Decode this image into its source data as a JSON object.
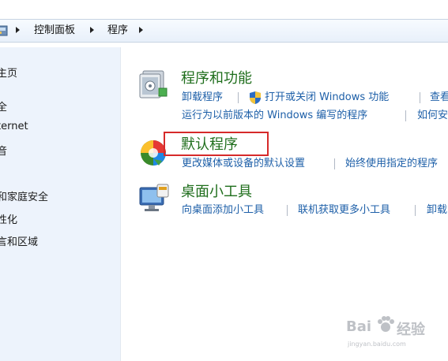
{
  "breadcrumb": {
    "items": [
      "控制面板",
      "程序"
    ]
  },
  "sidebar": {
    "items": [
      {
        "label": "主页"
      },
      {
        "label": "全"
      },
      {
        "label": "ternet"
      },
      {
        "label": "音"
      },
      {
        "label": "和家庭安全"
      },
      {
        "label": "性化"
      },
      {
        "label": "言和区域"
      }
    ]
  },
  "categories": [
    {
      "title": "程序和功能",
      "icon": "programs-features-icon",
      "links_row1": [
        "卸载程序",
        "打开或关闭 Windows 功能",
        "查看"
      ],
      "links_row2": [
        "运行为以前版本的 Windows 编写的程序",
        "如何安"
      ]
    },
    {
      "title": "默认程序",
      "icon": "default-programs-icon",
      "links_row1": [
        "更改媒体或设备的默认设置",
        "始终使用指定的程序"
      ]
    },
    {
      "title": "桌面小工具",
      "icon": "desktop-gadgets-icon",
      "links_row1": [
        "向桌面添加小工具",
        "联机获取更多小工具",
        "卸载"
      ]
    }
  ],
  "highlight": {
    "target": "默认程序",
    "color": "#d62a2a"
  },
  "colors": {
    "title_green": "#1f6e1c",
    "link_blue": "#1d5fa8",
    "sidebar_bg": "#edf3fc"
  },
  "watermark": {
    "brand": "Bai",
    "brand2": "经验",
    "url": "jingyan.baidu.com"
  }
}
